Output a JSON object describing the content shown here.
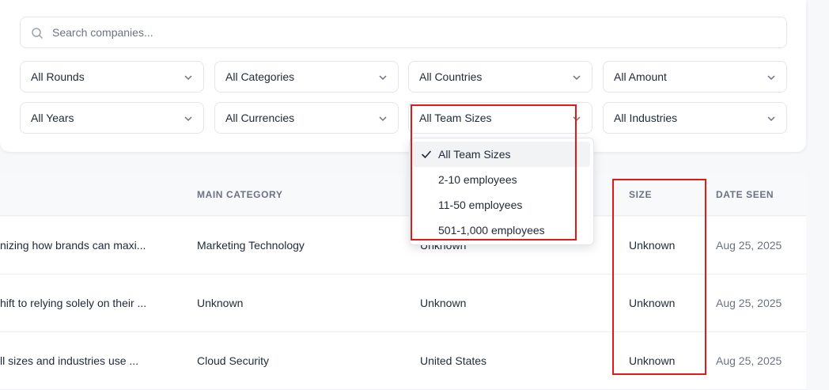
{
  "search": {
    "placeholder": "Search companies..."
  },
  "filters": {
    "rounds": "All Rounds",
    "categories": "All Categories",
    "countries": "All Countries",
    "amount": "All Amount",
    "years": "All Years",
    "currencies": "All Currencies",
    "team_sizes": "All Team Sizes",
    "industries": "All Industries"
  },
  "team_size_dropdown": {
    "options": [
      "All Team Sizes",
      "2-10 employees",
      "11-50 employees",
      "501-1,000 employees"
    ],
    "selected": "All Team Sizes"
  },
  "table": {
    "headers": {
      "main_category": "MAIN CATEGORY",
      "size": "SIZE",
      "date_seen": "DATE SEEN"
    },
    "rows": [
      {
        "description": "nizing how brands can maxi...",
        "main_category": "Marketing Technology",
        "country": "Unknown",
        "size": "Unknown",
        "date_seen": "Aug 25, 2025"
      },
      {
        "description": "hift to relying solely on their ...",
        "main_category": "Unknown",
        "country": "Unknown",
        "size": "Unknown",
        "date_seen": "Aug 25, 2025"
      },
      {
        "description": "ll sizes and industries use ...",
        "main_category": "Cloud Security",
        "country": "United States",
        "size": "Unknown",
        "date_seen": "Aug 25, 2025"
      }
    ]
  },
  "colors": {
    "highlight": "#e11919"
  }
}
